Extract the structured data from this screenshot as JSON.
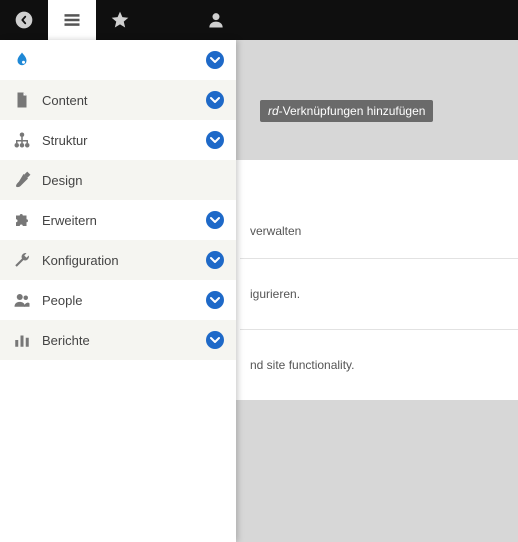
{
  "topbar": {
    "back_icon": "chevron-left",
    "menu_icon": "hamburger",
    "star_icon": "star",
    "user_icon": "user"
  },
  "pill": {
    "italic_part": "rd",
    "rest": "-Verknüpfungen hinzufügen"
  },
  "menu": {
    "brand": "drupal",
    "items": [
      {
        "id": "content",
        "label": "Content",
        "icon": "file",
        "expandable": true
      },
      {
        "id": "struktur",
        "label": "Struktur",
        "icon": "sitemap",
        "expandable": true
      },
      {
        "id": "design",
        "label": "Design",
        "icon": "brush",
        "expandable": false
      },
      {
        "id": "erweitern",
        "label": "Erweitern",
        "icon": "puzzle",
        "expandable": true
      },
      {
        "id": "konfig",
        "label": "Konfiguration",
        "icon": "wrench",
        "expandable": true
      },
      {
        "id": "people",
        "label": "People",
        "icon": "people",
        "expandable": true
      },
      {
        "id": "berichte",
        "label": "Berichte",
        "icon": "bars",
        "expandable": true
      }
    ]
  },
  "content_fragments": {
    "line1": "verwalten",
    "line2": "igurieren.",
    "line3": "nd site functionality."
  }
}
